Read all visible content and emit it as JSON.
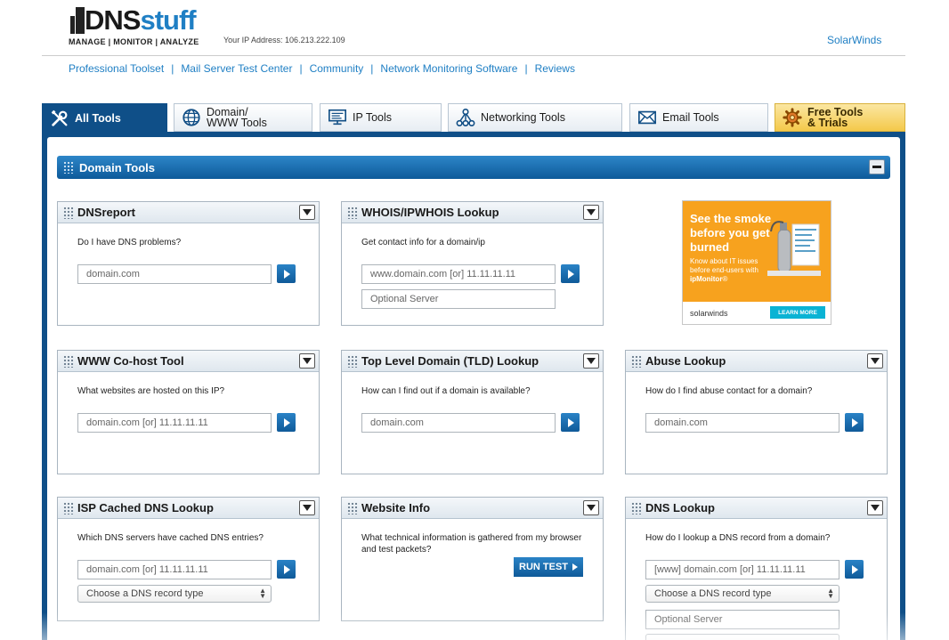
{
  "header": {
    "logo": {
      "dns": "DNS",
      "stuff": "stuff",
      "tagline": "MANAGE | MONITOR | ANALYZE"
    },
    "ip_address": "Your IP Address: 106.213.222.109",
    "solarwinds": "SolarWinds"
  },
  "nav": [
    "Professional Toolset",
    "Mail Server Test Center",
    "Community",
    "Network Monitoring Software",
    "Reviews"
  ],
  "nav_separator": "|",
  "tabs": [
    {
      "label": "All Tools"
    },
    {
      "label1": "Domain/",
      "label2": "WWW Tools"
    },
    {
      "label": "IP Tools"
    },
    {
      "label": "Networking Tools"
    },
    {
      "label": "Email Tools"
    },
    {
      "label1": "Free Tools",
      "label2": "& Trials"
    }
  ],
  "section": {
    "title": "Domain Tools"
  },
  "widgets": {
    "dnsreport": {
      "title": "DNSreport",
      "question": "Do I have DNS problems?",
      "placeholder": "domain.com"
    },
    "whois": {
      "title": "WHOIS/IPWHOIS Lookup",
      "question": "Get contact info for a domain/ip",
      "placeholder": "www.domain.com [or] 11.11.11.11",
      "server_placeholder": "Optional Server"
    },
    "cohost": {
      "title": "WWW Co-host Tool",
      "question": "What websites are hosted on this IP?",
      "placeholder": "domain.com [or] 11.11.11.11"
    },
    "tld": {
      "title": "Top Level Domain (TLD) Lookup",
      "question": "How can I find out if a domain is available?",
      "placeholder": "domain.com"
    },
    "abuse": {
      "title": "Abuse Lookup",
      "question": "How do I find abuse contact for a domain?",
      "placeholder": "domain.com"
    },
    "isp": {
      "title": "ISP Cached DNS Lookup",
      "question": "Which DNS servers have cached DNS entries?",
      "placeholder": "domain.com [or] 11.11.11.11",
      "select": "Choose a DNS record type"
    },
    "website": {
      "title": "Website Info",
      "question": "What technical information is gathered from my browser and test packets?",
      "button": "RUN TEST"
    },
    "dnslookup": {
      "title": "DNS Lookup",
      "question": "How do I lookup a DNS record from a domain?",
      "placeholder": "[www] domain.com [or] 11.11.11.11",
      "select": "Choose a DNS record type",
      "server_placeholder": "Optional Server"
    }
  },
  "ad": {
    "headline": "See the smoke before you get burned",
    "sub1": "Know about IT issues before end-users with ",
    "sub_brand": "ipMonitor",
    "sub_mark": "®",
    "brand": "solarwinds",
    "button": "LEARN MORE"
  },
  "colors": {
    "brand_blue": "#0f4f88",
    "link": "#1f7fc4",
    "ad_orange": "#f7a21e",
    "ad_button": "#0ab3d4"
  }
}
